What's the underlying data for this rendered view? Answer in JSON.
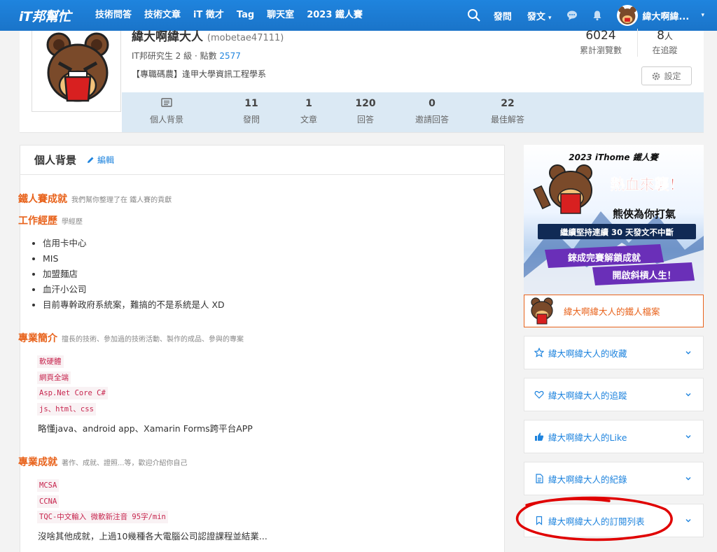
{
  "nav": {
    "logo": "iT邦幫忙",
    "items": [
      "技術問答",
      "技術文章",
      "iT 徵才",
      "Tag",
      "聊天室",
      "2023 鐵人賽"
    ],
    "ask": "發問",
    "post": "發文",
    "user_name": "緯大啊緯..."
  },
  "profile": {
    "name": "緯大啊緯大人",
    "handle": "(mobetae47111)",
    "rank": "IT邦研究生 2 級 · 點數",
    "points": "2577",
    "tag": "【專職碼農】逢甲大學資訊工程學系",
    "views": "6024",
    "views_label": "累計瀏覽數",
    "followers": "8",
    "followers_unit": "人",
    "followers_label": "在追蹤",
    "settings": "設定",
    "stats": [
      {
        "num": "",
        "label": "個人背景"
      },
      {
        "num": "11",
        "label": "發問"
      },
      {
        "num": "1",
        "label": "文章"
      },
      {
        "num": "120",
        "label": "回答"
      },
      {
        "num": "0",
        "label": "邀請回答"
      },
      {
        "num": "22",
        "label": "最佳解答"
      }
    ]
  },
  "main": {
    "title": "個人背景",
    "edit": "編輯",
    "ironman_title": "鐵人賽成就",
    "ironman_sub": "我們幫你整理了在 鐵人賽的貢獻",
    "work_title": "工作經歷",
    "work_sub": "學經歷",
    "work_items": [
      "信用卡中心",
      "MIS",
      "加盟麵店",
      "血汗小公司",
      "目前專幹政府系統案，難搞的不是系統是人 XD"
    ],
    "skills_title": "專業簡介",
    "skills_sub": "擅長的技術、參加過的技術活動、製作的成品、參與的專案",
    "skills_tags": [
      "軟硬體",
      "網頁全端",
      "Asp.Net Core C#",
      "js、html、css"
    ],
    "skills_text": "略懂java、android app、Xamarin Forms跨平台APP",
    "achv_title": "專業成就",
    "achv_sub": "著作、成就、證照...等，歡迎介紹你自己",
    "achv_tags": [
      "MCSA",
      "CCNA",
      "TQC-中文輸入 微軟新注音 95字/min"
    ],
    "achv_text": "沒啥其他成就，上過10幾種各大電腦公司認證課程並結業..."
  },
  "sidebar": {
    "banner_title": "2023 iThome 鐵人賽",
    "banner_l1": "熱血來襲！",
    "banner_l2": "熊俠為你打氣",
    "banner_l3": "繼續堅持連續 30 天發文不中斷",
    "banner_l4": "錸成完賽解鎖成就",
    "banner_l5": "開啟斜槓人生！",
    "ironman_link": "緯大啊緯大人的鐵人檔案",
    "items": [
      "緯大啊緯大人的收藏",
      "緯大啊緯大人的追蹤",
      "緯大啊緯大人的Like",
      "緯大啊緯大人的紀錄",
      "緯大啊緯大人的訂閱列表"
    ]
  },
  "colors": {
    "brand": "#1f84de",
    "accent": "#e8631c",
    "annotation": "#e00000"
  }
}
